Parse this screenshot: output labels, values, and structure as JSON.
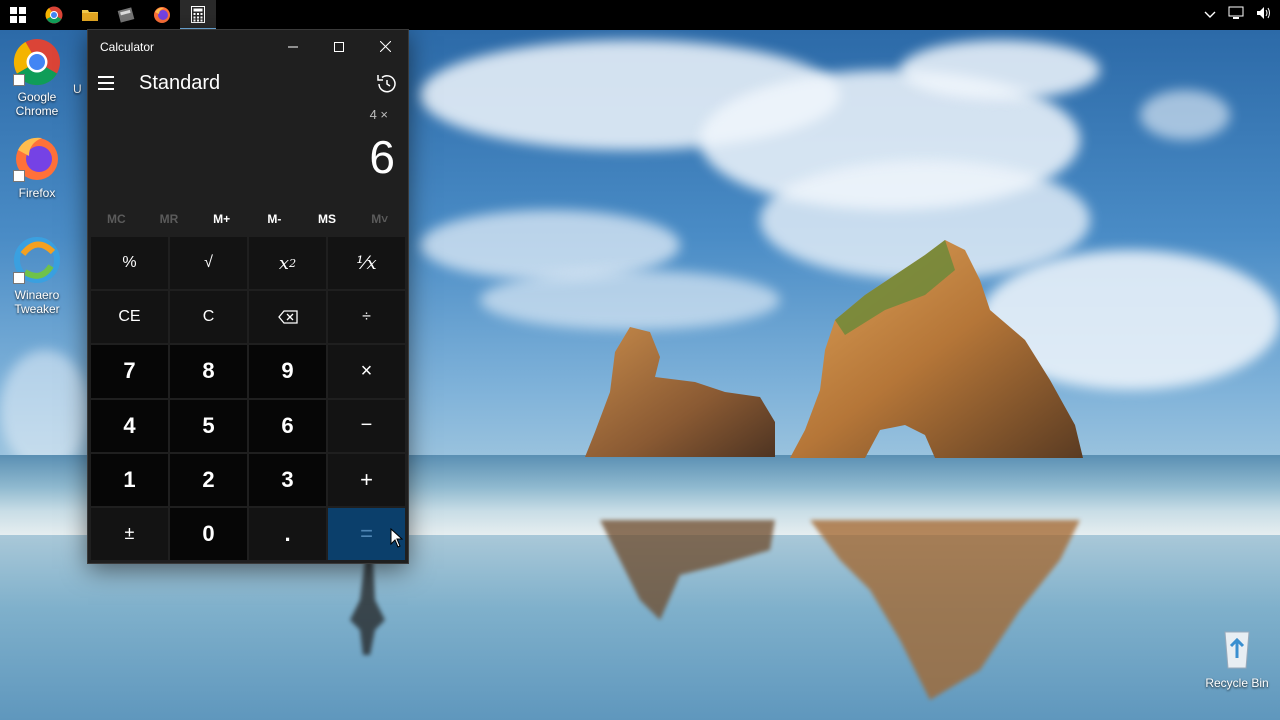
{
  "taskbar": {
    "items": [
      {
        "icon": "windows-start-icon"
      },
      {
        "icon": "chrome-icon"
      },
      {
        "icon": "file-explorer-icon"
      },
      {
        "icon": "winaero-tweaker-icon"
      },
      {
        "icon": "firefox-icon"
      },
      {
        "icon": "calculator-icon",
        "active": true
      }
    ],
    "tray": [
      "chevron-up-icon",
      "network-icon",
      "volume-icon"
    ]
  },
  "desktop": {
    "icons": [
      {
        "label": "Google Chrome",
        "icon": "chrome-icon"
      },
      {
        "label": "Firefox",
        "icon": "firefox-icon"
      },
      {
        "label": "Winaero Tweaker",
        "icon": "winaero-tweaker-icon"
      },
      {
        "label": "Recycle Bin",
        "icon": "recycle-bin-icon"
      }
    ],
    "partial_label": "U"
  },
  "calculator": {
    "window_title": "Calculator",
    "mode": "Standard",
    "expression": "4 ×",
    "display": "6",
    "memory": [
      {
        "label": "MC",
        "enabled": false
      },
      {
        "label": "MR",
        "enabled": false
      },
      {
        "label": "M+",
        "enabled": true
      },
      {
        "label": "M-",
        "enabled": true
      },
      {
        "label": "MS",
        "enabled": true
      },
      {
        "label": "M˅",
        "enabled": false
      }
    ],
    "keys": {
      "percent": "%",
      "sqrt": "√",
      "square": "x",
      "square_sup": "2",
      "reciprocal": "¹⁄x",
      "ce": "CE",
      "c": "C",
      "backspace": "backspace-icon",
      "divide": "÷",
      "seven": "7",
      "eight": "8",
      "nine": "9",
      "multiply": "×",
      "four": "4",
      "five": "5",
      "six": "6",
      "minus": "−",
      "one": "1",
      "two": "2",
      "three": "3",
      "plus": "+",
      "negate": "±",
      "zero": "0",
      "decimal": ".",
      "equals": "="
    },
    "colors": {
      "equals_bg": "#0b3f6b",
      "window_bg": "#1f1f1f"
    }
  }
}
